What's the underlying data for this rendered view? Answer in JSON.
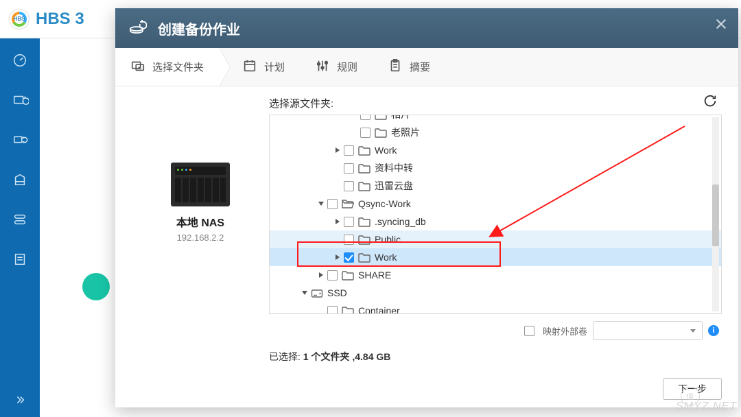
{
  "app": {
    "title": "HBS 3"
  },
  "modal": {
    "title": "创建备份作业",
    "steps": [
      {
        "label": "选择文件夹",
        "icon": "folder-select"
      },
      {
        "label": "计划",
        "icon": "calendar"
      },
      {
        "label": "规则",
        "icon": "sliders"
      },
      {
        "label": "摘要",
        "icon": "clipboard"
      }
    ],
    "active_step": 0
  },
  "device": {
    "name": "本地 NAS",
    "ip": "192.168.2.2"
  },
  "picker": {
    "label": "选择源文件夹:",
    "rows": [
      {
        "indent": 4,
        "expander": "none",
        "checked": false,
        "icon": "folder",
        "name": "相片",
        "truncated": true
      },
      {
        "indent": 4,
        "expander": "none",
        "checked": false,
        "icon": "folder",
        "name": "老照片"
      },
      {
        "indent": 3,
        "expander": "closed",
        "checked": false,
        "icon": "folder",
        "name": "Work"
      },
      {
        "indent": 3,
        "expander": "none",
        "checked": false,
        "icon": "folder",
        "name": "资料中转"
      },
      {
        "indent": 3,
        "expander": "none",
        "checked": false,
        "icon": "folder",
        "name": "迅雷云盘"
      },
      {
        "indent": 2,
        "expander": "open",
        "checked": false,
        "icon": "folder-open",
        "name": "Qsync-Work"
      },
      {
        "indent": 3,
        "expander": "closed",
        "checked": false,
        "icon": "folder",
        "name": ".syncing_db"
      },
      {
        "indent": 3,
        "expander": "none",
        "checked": false,
        "icon": "folder",
        "name": "Public",
        "state": "hover"
      },
      {
        "indent": 3,
        "expander": "closed",
        "checked": true,
        "icon": "folder",
        "name": "Work",
        "state": "selected"
      },
      {
        "indent": 2,
        "expander": "closed",
        "checked": false,
        "icon": "folder",
        "name": "SHARE"
      },
      {
        "indent": 1,
        "expander": "open",
        "checked": false,
        "icon": "disk",
        "name": "SSD",
        "no_checkbox": true
      },
      {
        "indent": 2,
        "expander": "none",
        "checked": false,
        "icon": "folder",
        "name": "Container",
        "truncated": true
      }
    ],
    "map_ext_label": "映射外部卷"
  },
  "summary": {
    "prefix": "已选择: ",
    "value": "1 个文件夹 ,4.84 GB"
  },
  "footer": {
    "next": "下一步"
  },
  "watermark": "SMYZ.NET"
}
